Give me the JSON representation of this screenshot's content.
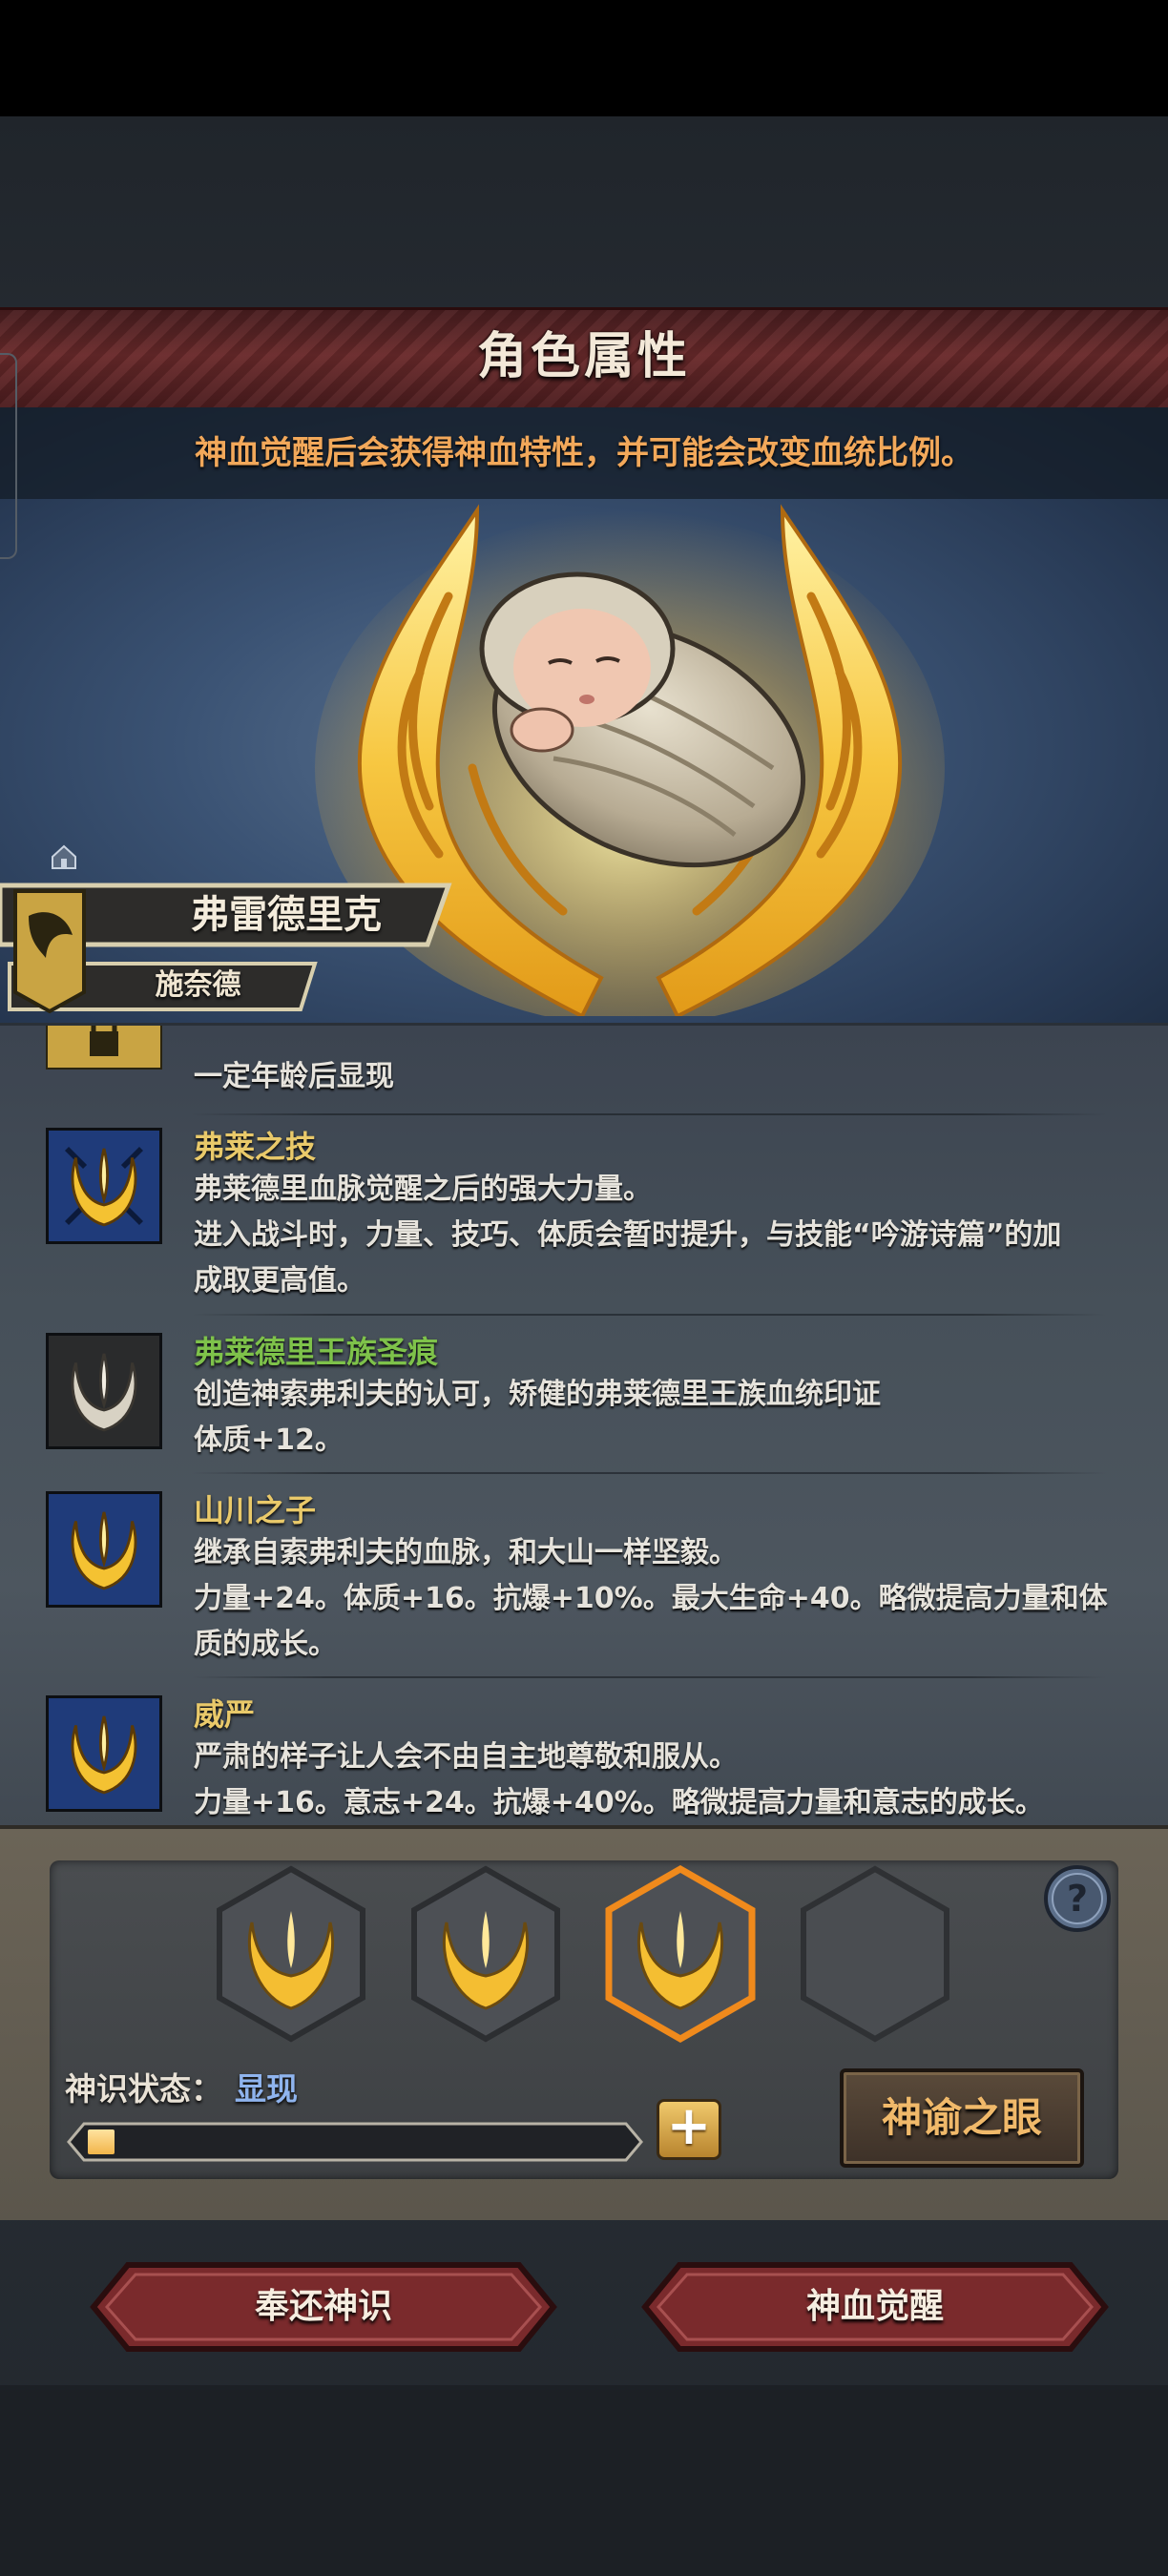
{
  "header": {
    "title": "角色属性"
  },
  "hero": {
    "tip": "神血觉醒后会获得神血特性，并可能会改变血统比例。",
    "name": "弗雷德里克",
    "family": "施奈德"
  },
  "traits": [
    {
      "name": "",
      "lines": [
        "一定年龄后显现"
      ],
      "name_color": "#e9c96a",
      "icon": "lock-icon"
    },
    {
      "name": "弗莱之技",
      "lines": [
        "弗莱德里血脉觉醒之后的强大力量。",
        "进入战斗时，力量、技巧、体质会暂时提升，与技能“吟游诗篇”的加",
        "成取更高值。"
      ],
      "name_color": "#e9c96a",
      "icon": "gold-crest-icon"
    },
    {
      "name": "弗莱德里王族圣痕",
      "lines": [
        "创造神索弗利夫的认可，矫健的弗莱德里王族血统印证",
        "体质+12。"
      ],
      "name_color": "#7ec24a",
      "icon": "silver-crest-icon"
    },
    {
      "name": "山川之子",
      "lines": [
        "继承自索弗利夫的血脉，和大山一样坚毅。",
        "力量+24。体质+16。抗爆+10%。最大生命+40。略微提高力量和体",
        "质的成长。"
      ],
      "name_color": "#e9c96a",
      "icon": "gold-crest-icon"
    },
    {
      "name": "威严",
      "lines": [
        "严肃的样子让人会不由自主地尊敬和服从。",
        "力量+16。意志+24。抗爆+40%。略微提高力量和意志的成长。"
      ],
      "name_color": "#e9c96a",
      "icon": "gold-crest-icon"
    }
  ],
  "slots": [
    {
      "filled": true,
      "selected": false
    },
    {
      "filled": true,
      "selected": false
    },
    {
      "filled": true,
      "selected": true
    },
    {
      "filled": false,
      "selected": false
    }
  ],
  "divine_sense": {
    "label": "神识状态：",
    "value": "显现",
    "progress": 0.05
  },
  "buttons": {
    "oracle_eye": "神谕之眼",
    "return_sense": "奉还神识",
    "awaken": "神血觉醒",
    "help": "?",
    "plus": "+"
  },
  "colors": {
    "accent_gold": "#f0b96a",
    "trait_gold": "#e9c96a",
    "trait_green": "#7ec24a",
    "tip_orange": "#f2a85a",
    "status_blue": "#8fb4ee",
    "title_red": "#6a2a2b"
  }
}
